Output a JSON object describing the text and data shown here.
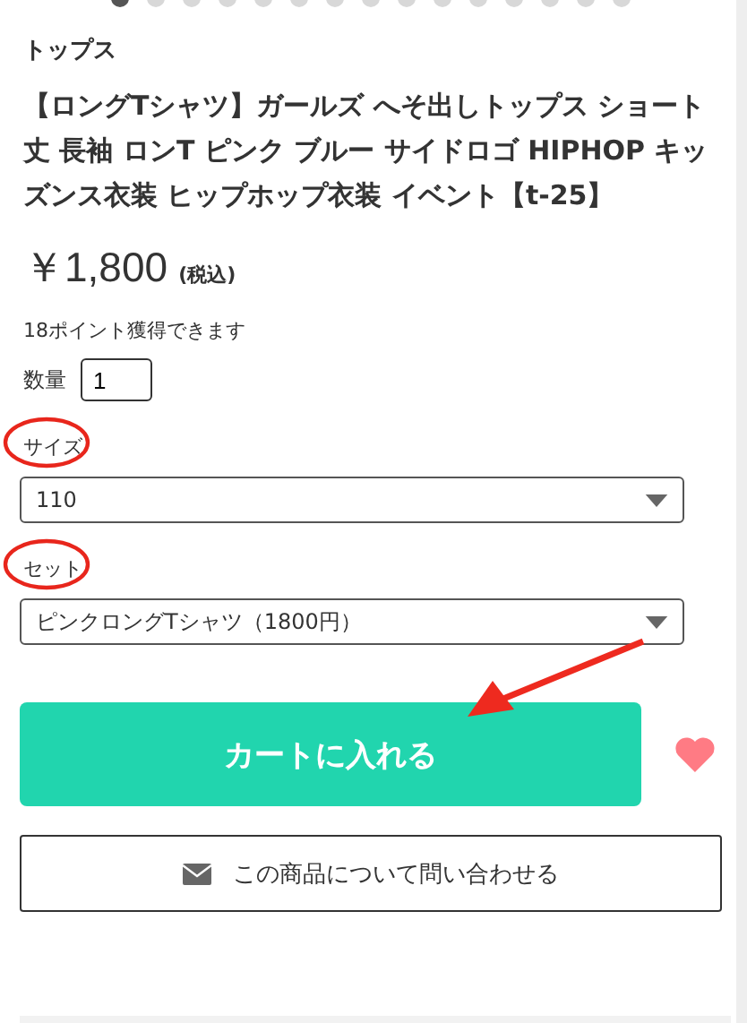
{
  "carousel_dots": [
    {
      "selected": true
    },
    {
      "selected": false
    },
    {
      "selected": false
    },
    {
      "selected": false
    },
    {
      "selected": false
    },
    {
      "selected": false
    },
    {
      "selected": false
    },
    {
      "selected": false
    },
    {
      "selected": false
    },
    {
      "selected": false
    },
    {
      "selected": false
    },
    {
      "selected": false
    },
    {
      "selected": false
    },
    {
      "selected": false
    },
    {
      "selected": false
    }
  ],
  "category": "トップス",
  "title": "【ロングTシャツ】ガールズ へそ出しトップス ショート丈 長袖 ロンT ピンク ブルー サイドロゴ HIPHOP キッズンス衣装 ヒップホップ衣装 イベント【t-25】",
  "price": "￥1,800",
  "tax_note": "(税込)",
  "points": "18ポイント獲得できます",
  "quantity": {
    "label": "数量",
    "value": "1"
  },
  "options": [
    {
      "label": "サイズ",
      "value": "110"
    },
    {
      "label": "セット",
      "value": "ピンクロングTシャツ（1800円）"
    }
  ],
  "cart_button": "カートに入れる",
  "inquiry_button": "この商品について問い合わせる"
}
